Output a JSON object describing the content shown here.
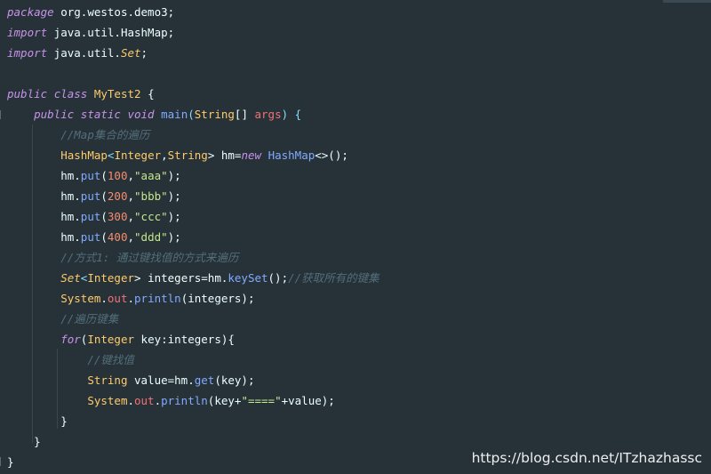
{
  "lines": [
    [
      {
        "t": "package",
        "c": "kw"
      },
      {
        "t": " org.westos.demo3;",
        "c": "pl"
      }
    ],
    [
      {
        "t": "import",
        "c": "kw"
      },
      {
        "t": " java.util.HashMap;",
        "c": "pl"
      }
    ],
    [
      {
        "t": "import",
        "c": "kw"
      },
      {
        "t": " java.util.",
        "c": "pl"
      },
      {
        "t": "Set",
        "c": "tp kwi"
      },
      {
        "t": ";",
        "c": "pl"
      }
    ],
    [],
    [
      {
        "t": "public",
        "c": "kw"
      },
      {
        "t": " ",
        "c": "pl"
      },
      {
        "t": "class",
        "c": "kw"
      },
      {
        "t": " ",
        "c": "pl"
      },
      {
        "t": "MyTest2",
        "c": "tp"
      },
      {
        "t": " {",
        "c": "pl"
      }
    ],
    [
      {
        "t": "    ",
        "c": "pl"
      },
      {
        "t": "public",
        "c": "kw"
      },
      {
        "t": " ",
        "c": "pl"
      },
      {
        "t": "static",
        "c": "kw"
      },
      {
        "t": " ",
        "c": "pl"
      },
      {
        "t": "void",
        "c": "kw"
      },
      {
        "t": " ",
        "c": "pl"
      },
      {
        "t": "main",
        "c": "fn"
      },
      {
        "t": "(",
        "c": "pn"
      },
      {
        "t": "String",
        "c": "tp"
      },
      {
        "t": "[] ",
        "c": "pl"
      },
      {
        "t": "args",
        "c": "fd"
      },
      {
        "t": ") {",
        "c": "pn"
      }
    ],
    [
      {
        "t": "        ",
        "c": "pl"
      },
      {
        "t": "//Map集合的遍历",
        "c": "cm"
      }
    ],
    [
      {
        "t": "        ",
        "c": "pl"
      },
      {
        "t": "HashMap",
        "c": "tp"
      },
      {
        "t": "<",
        "c": "pn"
      },
      {
        "t": "Integer",
        "c": "tp"
      },
      {
        "t": ",",
        "c": "pl"
      },
      {
        "t": "String",
        "c": "tp"
      },
      {
        "t": "> hm=",
        "c": "pl"
      },
      {
        "t": "new",
        "c": "kw"
      },
      {
        "t": " ",
        "c": "pl"
      },
      {
        "t": "HashMap",
        "c": "fn"
      },
      {
        "t": "<>();",
        "c": "pl"
      }
    ],
    [
      {
        "t": "        hm.",
        "c": "pl"
      },
      {
        "t": "put",
        "c": "fn"
      },
      {
        "t": "(",
        "c": "pl"
      },
      {
        "t": "100",
        "c": "num"
      },
      {
        "t": ",",
        "c": "pl"
      },
      {
        "t": "\"aaa\"",
        "c": "str"
      },
      {
        "t": ");",
        "c": "pl"
      }
    ],
    [
      {
        "t": "        hm.",
        "c": "pl"
      },
      {
        "t": "put",
        "c": "fn"
      },
      {
        "t": "(",
        "c": "pl"
      },
      {
        "t": "200",
        "c": "num"
      },
      {
        "t": ",",
        "c": "pl"
      },
      {
        "t": "\"bbb\"",
        "c": "str"
      },
      {
        "t": ");",
        "c": "pl"
      }
    ],
    [
      {
        "t": "        hm.",
        "c": "pl"
      },
      {
        "t": "put",
        "c": "fn"
      },
      {
        "t": "(",
        "c": "pl"
      },
      {
        "t": "300",
        "c": "num"
      },
      {
        "t": ",",
        "c": "pl"
      },
      {
        "t": "\"ccc\"",
        "c": "str"
      },
      {
        "t": ");",
        "c": "pl"
      }
    ],
    [
      {
        "t": "        hm.",
        "c": "pl"
      },
      {
        "t": "put",
        "c": "fn"
      },
      {
        "t": "(",
        "c": "pl"
      },
      {
        "t": "400",
        "c": "num"
      },
      {
        "t": ",",
        "c": "pl"
      },
      {
        "t": "\"ddd\"",
        "c": "str"
      },
      {
        "t": ");",
        "c": "pl"
      }
    ],
    [
      {
        "t": "        ",
        "c": "pl"
      },
      {
        "t": "//方式1: 通过键找值的方式来遍历",
        "c": "cm"
      }
    ],
    [
      {
        "t": "        ",
        "c": "pl"
      },
      {
        "t": "Set",
        "c": "tp kwi"
      },
      {
        "t": "<",
        "c": "pn"
      },
      {
        "t": "Integer",
        "c": "tp"
      },
      {
        "t": "> integers=hm.",
        "c": "pl"
      },
      {
        "t": "keySet",
        "c": "fn"
      },
      {
        "t": "();",
        "c": "pl"
      },
      {
        "t": "//获取所有的键集",
        "c": "cm"
      }
    ],
    [
      {
        "t": "        ",
        "c": "pl"
      },
      {
        "t": "System",
        "c": "tp"
      },
      {
        "t": ".",
        "c": "pl"
      },
      {
        "t": "out",
        "c": "fd"
      },
      {
        "t": ".",
        "c": "pl"
      },
      {
        "t": "println",
        "c": "fn"
      },
      {
        "t": "(integers);",
        "c": "pl"
      }
    ],
    [
      {
        "t": "        ",
        "c": "pl"
      },
      {
        "t": "//遍历键集",
        "c": "cm"
      }
    ],
    [
      {
        "t": "        ",
        "c": "pl"
      },
      {
        "t": "for",
        "c": "kw"
      },
      {
        "t": "(",
        "c": "pl"
      },
      {
        "t": "Integer",
        "c": "tp"
      },
      {
        "t": " key:integers){",
        "c": "pl"
      }
    ],
    [
      {
        "t": "            ",
        "c": "pl"
      },
      {
        "t": "//键找值",
        "c": "cm"
      }
    ],
    [
      {
        "t": "            ",
        "c": "pl"
      },
      {
        "t": "String",
        "c": "tp"
      },
      {
        "t": " value=hm.",
        "c": "pl"
      },
      {
        "t": "get",
        "c": "fn"
      },
      {
        "t": "(key);",
        "c": "pl"
      }
    ],
    [
      {
        "t": "            ",
        "c": "pl"
      },
      {
        "t": "System",
        "c": "tp"
      },
      {
        "t": ".",
        "c": "pl"
      },
      {
        "t": "out",
        "c": "fd"
      },
      {
        "t": ".",
        "c": "pl"
      },
      {
        "t": "println",
        "c": "fn"
      },
      {
        "t": "(key+",
        "c": "pl"
      },
      {
        "t": "\"====\"",
        "c": "str"
      },
      {
        "t": "+value);",
        "c": "pl"
      }
    ],
    [
      {
        "t": "        }",
        "c": "pl"
      }
    ],
    [
      {
        "t": "    }",
        "c": "pl"
      }
    ],
    [
      {
        "t": "}",
        "c": "pl"
      }
    ]
  ],
  "watermark": "https://blog.csdn.net/ITzhazhassc",
  "colors": {
    "background": "#263238",
    "keyword": "#c792ea",
    "type": "#ffcb6b",
    "function": "#82aaff",
    "string": "#c3e88d",
    "number": "#f78c6c",
    "comment": "#546e7a",
    "field": "#f07178"
  }
}
